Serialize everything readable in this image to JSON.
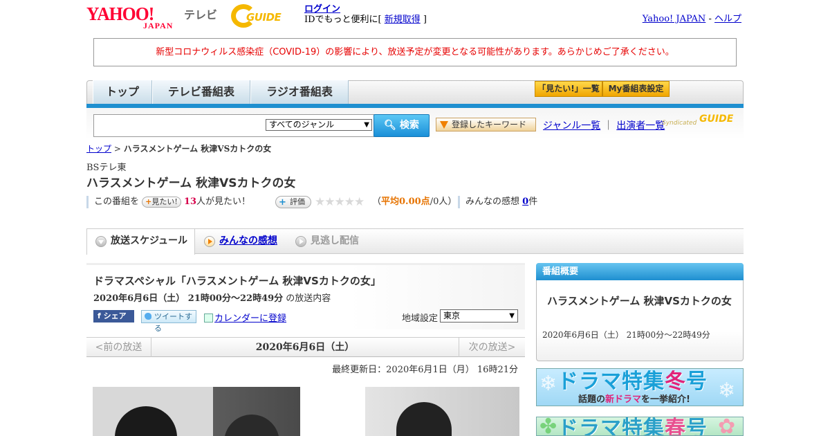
{
  "header": {
    "yahoo_logo_main": "YAHOO!",
    "yahoo_logo_sub": "JAPAN",
    "tv_label": "テレビ",
    "gguide_logo": "GUIDE",
    "login_link": "ログイン",
    "login_text_prefix": "IDでもっと便利に[ ",
    "signup_link": "新規取得",
    "login_text_suffix": " ]",
    "yahoo_japan_link": "Yahoo! JAPAN",
    "separator": " - ",
    "help_link": "ヘルプ"
  },
  "notice": "新型コロナウィルス感染症（COVID-19）の影響により、放送予定が変更となる可能性があります。あらかじめご了承ください。",
  "nav": {
    "tabs": [
      "トップ",
      "テレビ番組表",
      "ラジオ番組表"
    ],
    "mitai_list": "「見たい!」一覧",
    "my_settings": "My番組表設定"
  },
  "search": {
    "input_value": "",
    "genre_selected": "すべてのジャンル",
    "search_button": "検索",
    "keyword_button": "登録したキーワード",
    "genre_list_link": "ジャンル一覧",
    "divider": "｜",
    "cast_list_link": "出演者一覧",
    "syndicated": "Syndicated",
    "syndicated_logo": "GUIDE"
  },
  "breadcrumb": {
    "top": "トップ",
    "sep": " > ",
    "current": "ハラスメントゲーム 秋津VSカトクの女"
  },
  "program": {
    "station": "BSテレ東",
    "title": "ハラスメントゲーム 秋津VSカトクの女",
    "mitai_prefix": "この番組を",
    "mitai_button": "見たい!",
    "mitai_count": "13",
    "mitai_suffix": "人が見たい！",
    "rating_button": "評価",
    "stars": "★★★★★",
    "avg_open": "（",
    "avg_label": "平均0.00点",
    "avg_suffix": "/0人）",
    "impressions_label": "みんなの感想 ",
    "impressions_count": "0",
    "impressions_unit": "件"
  },
  "tabs": {
    "schedule": "放送スケジュール",
    "impressions": "みんなの感想",
    "catchup": "見逃し配信"
  },
  "broadcast": {
    "title": "ドラマスペシャル「ハラスメントゲーム 秋津VSカトクの女」",
    "datetime": "2020年6月6日（土） 21時00分～22時49分",
    "datetime_suffix": " の放送内容",
    "share_button": "シェア",
    "tweet_button": "ツイートする",
    "calendar_link": "カレンダーに登録",
    "region_label": "地域設定",
    "region_selected": "東京",
    "prev": "<前の放送",
    "date": "2020年6月6日（土）",
    "next": "次の放送>",
    "updated": "最終更新日：2020年6月1日（月） 16時21分"
  },
  "sidebar": {
    "heading": "番組概要",
    "title": "ハラスメントゲーム 秋津VSカトクの女",
    "time": "2020年6月6日（土） 21時00分～22時49分",
    "banner1_main": "ドラマ特集",
    "banner1_season": "冬",
    "banner1_end": "号",
    "banner1_sub_prefix": "話題の",
    "banner1_sub_red": "新ドラマ",
    "banner1_sub_suffix": "を一挙紹介!",
    "banner2_main": "ドラマ特集",
    "banner2_season": "春",
    "banner2_end": "号"
  },
  "colors": {
    "accent_blue": "#1e8fd0",
    "notice_red": "#e60000",
    "gguide_yellow": "#f5b800",
    "yahoo_red": "#ff0033"
  }
}
